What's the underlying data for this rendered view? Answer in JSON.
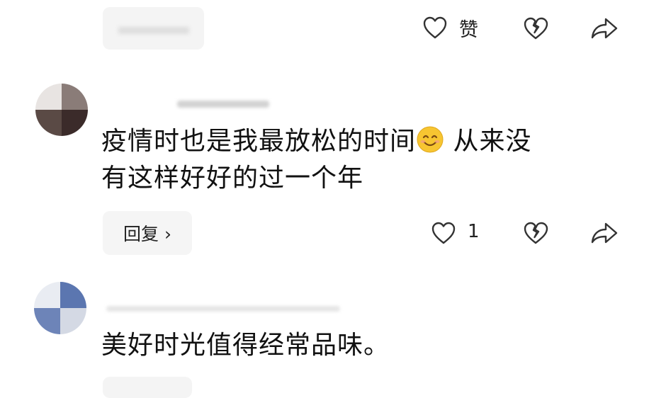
{
  "top_row": {
    "like_label": "赞"
  },
  "comments": [
    {
      "text_line1": "疫情时也是我最放松的时间",
      "text_line1_after": " 从来没",
      "text_line2": "有这样好好的过一个年",
      "emoji_icon": "smiling-face-emoji-icon",
      "reply_label": "回复 ›",
      "like_count": "1"
    },
    {
      "text_line1": "美好时光值得经常品味。"
    }
  ],
  "icons": {
    "like": "heart-outline-icon",
    "dislike": "broken-heart-icon",
    "share": "share-arrow-icon"
  },
  "colors": {
    "icon_stroke": "#333333",
    "pill_bg": "#f5f5f5",
    "emoji_face": "#f7c531"
  }
}
